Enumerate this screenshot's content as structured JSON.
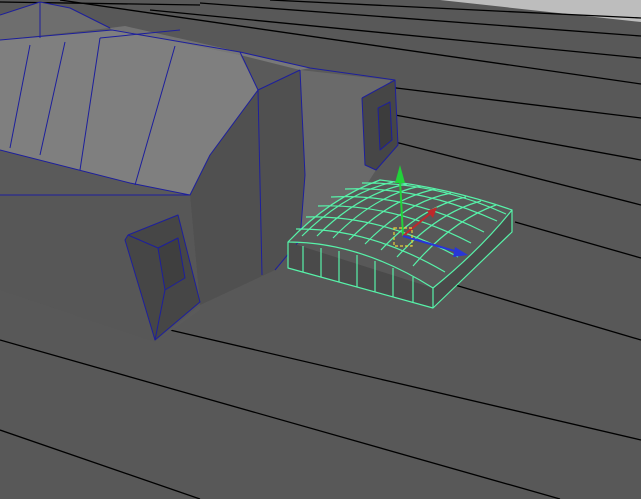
{
  "viewport": {
    "background_color": "#585858",
    "horizon_color": "#bdbdbd",
    "grid_color": "#000000",
    "mesh_face_color": "#5d5d5d",
    "mesh_wire_color": "#1d1f9c",
    "selection_wire_color": "#57f2a9"
  },
  "manipulator": {
    "x_axis_color": "#c0282a",
    "y_axis_color": "#22d23a",
    "z_axis_color": "#2836d8",
    "pivot_color": "#e6d23a"
  }
}
